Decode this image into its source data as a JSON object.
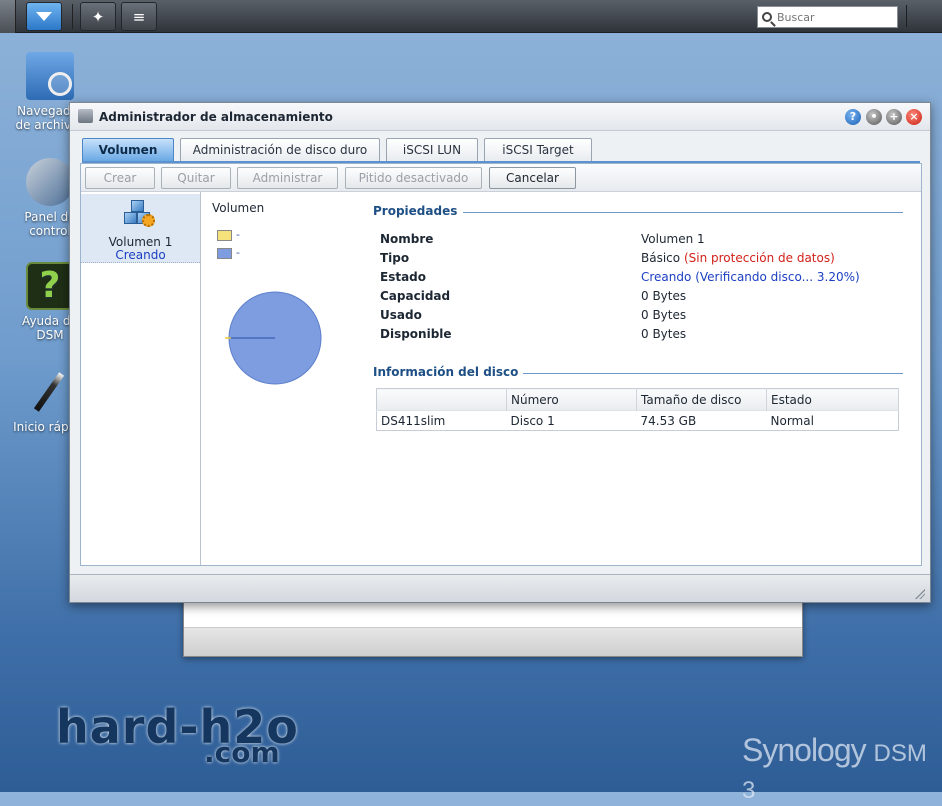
{
  "taskbar": {
    "search_placeholder": "Buscar"
  },
  "desktop": {
    "icons": [
      {
        "label": "Navegador de archivos"
      },
      {
        "label": "Panel de control"
      },
      {
        "label": "Ayuda de DSM"
      },
      {
        "label": "Inicio rápido"
      }
    ]
  },
  "window": {
    "title": "Administrador de almacenamiento",
    "tabs": [
      "Volumen",
      "Administración de disco duro",
      "iSCSI LUN",
      "iSCSI Target"
    ],
    "toolbar": {
      "create": "Crear",
      "remove": "Quitar",
      "manage": "Administrar",
      "beep": "Pitido desactivado",
      "cancel": "Cancelar"
    },
    "volume_list": [
      {
        "name": "Volumen 1",
        "status": "Creando"
      }
    ],
    "chart": {
      "title": "Volumen",
      "legend": [
        {
          "label": "-",
          "color": "#f5e27a"
        },
        {
          "label": "-",
          "color": "#7e9de0"
        }
      ]
    },
    "properties": {
      "heading": "Propiedades",
      "rows": [
        {
          "key": "Nombre",
          "value": "Volumen 1"
        },
        {
          "key": "Tipo",
          "value": "Básico",
          "note": "(Sin protección de datos)"
        },
        {
          "key": "Estado",
          "value": "Creando",
          "note": "(Verificando disco... 3.20%)"
        },
        {
          "key": "Capacidad",
          "value": "0 Bytes"
        },
        {
          "key": "Usado",
          "value": "0 Bytes"
        },
        {
          "key": "Disponible",
          "value": "0 Bytes"
        }
      ]
    },
    "disk_info": {
      "heading": "Información del disco",
      "columns": [
        "",
        "Número",
        "Tamaño de disco",
        "Estado"
      ],
      "rows": [
        {
          "name": "DS411slim",
          "number": "Disco 1",
          "size": "74.53 GB",
          "status": "Normal"
        }
      ]
    }
  },
  "watermark": {
    "brand": "hard-h2o",
    "domain": ".com",
    "product": "Synology",
    "product_suffix": "DSM 3"
  },
  "colors": {
    "accent_blue": "#4c86c6",
    "status_red": "#d1211a",
    "status_blue": "#1c3fc2",
    "status_green": "#1a8a28"
  }
}
